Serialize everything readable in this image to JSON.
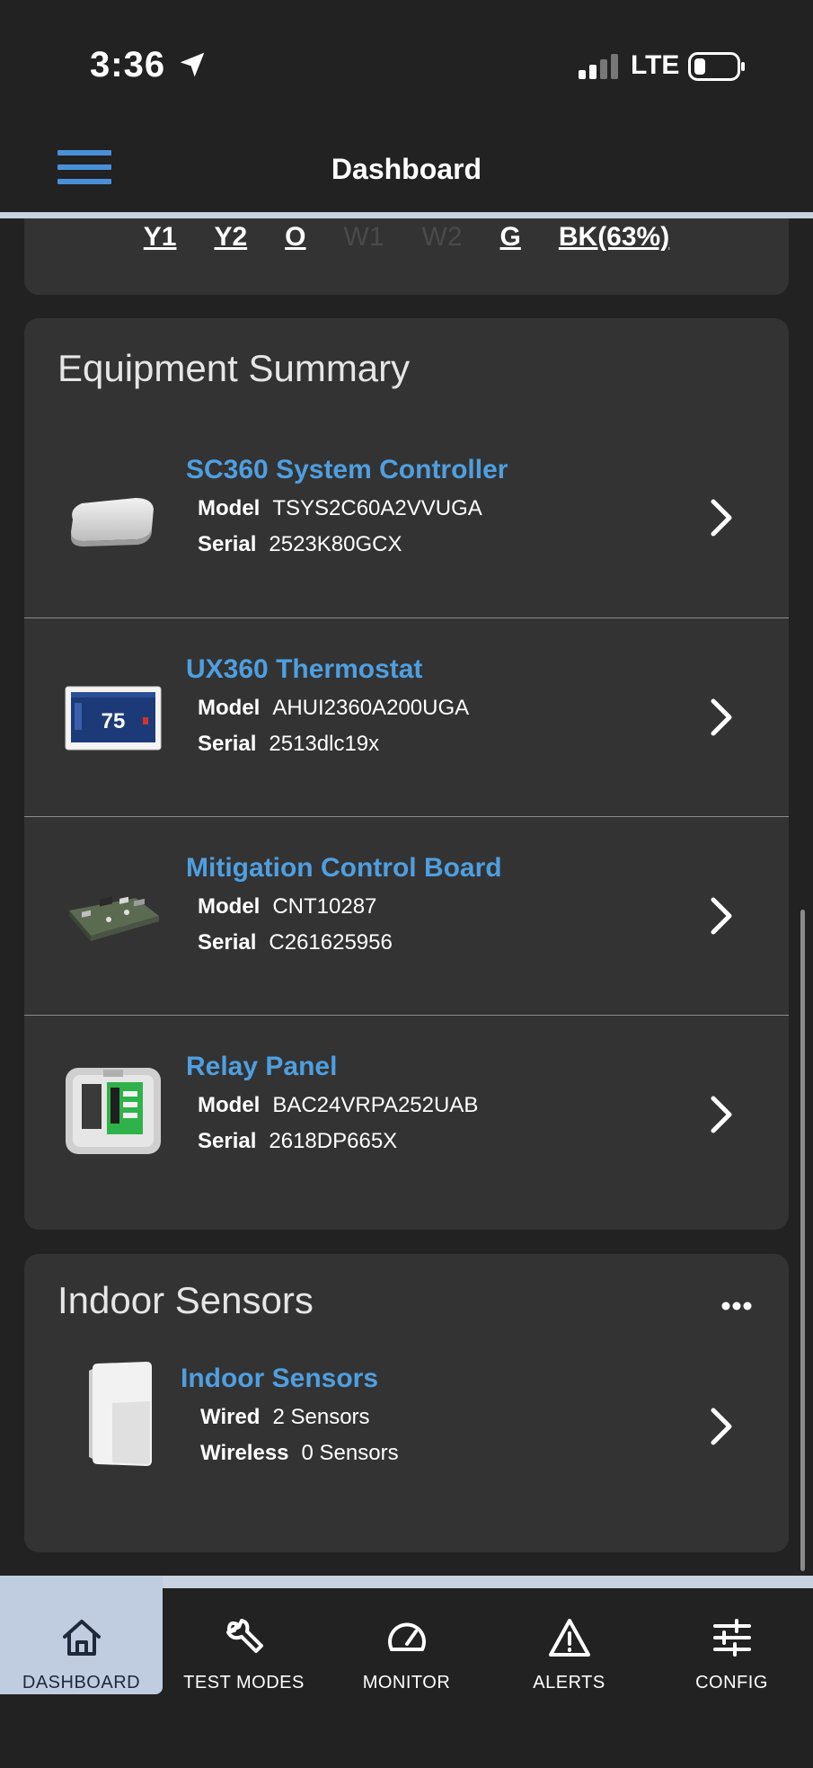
{
  "status_bar": {
    "time": "3:36",
    "network": "LTE"
  },
  "header": {
    "title": "Dashboard"
  },
  "stages": [
    {
      "label": "Y1",
      "active": true
    },
    {
      "label": "Y2",
      "active": true
    },
    {
      "label": "O",
      "active": true
    },
    {
      "label": "W1",
      "active": false
    },
    {
      "label": "W2",
      "active": false
    },
    {
      "label": "G",
      "active": true
    },
    {
      "label": "BK(63%)",
      "active": true
    }
  ],
  "equipment": {
    "title": "Equipment Summary",
    "items": [
      {
        "name": "SC360 System Controller",
        "model_label": "Model",
        "model": "TSYS2C60A2VVUGA",
        "serial_label": "Serial",
        "serial": "2523K80GCX",
        "icon": "controller-icon"
      },
      {
        "name": "UX360 Thermostat",
        "model_label": "Model",
        "model": "AHUI2360A200UGA",
        "serial_label": "Serial",
        "serial": "2513dlc19x",
        "icon": "thermostat-icon",
        "screen_temp": "75"
      },
      {
        "name": "Mitigation Control Board",
        "model_label": "Model",
        "model": "CNT10287",
        "serial_label": "Serial",
        "serial": "C261625956",
        "icon": "circuit-board-icon"
      },
      {
        "name": "Relay Panel",
        "model_label": "Model",
        "model": "BAC24VRPA252UAB",
        "serial_label": "Serial",
        "serial": "2618DP665X",
        "icon": "relay-panel-icon"
      }
    ]
  },
  "sensors": {
    "title": "Indoor Sensors",
    "item": {
      "name": "Indoor Sensors",
      "wired_label": "Wired",
      "wired": "2 Sensors",
      "wireless_label": "Wireless",
      "wireless": "0 Sensors"
    }
  },
  "tabs": [
    {
      "label": "DASHBOARD",
      "icon": "home-icon",
      "active": true
    },
    {
      "label": "TEST MODES",
      "icon": "wrench-icon",
      "active": false
    },
    {
      "label": "MONITOR",
      "icon": "gauge-icon",
      "active": false
    },
    {
      "label": "ALERTS",
      "icon": "warning-icon",
      "active": false
    },
    {
      "label": "CONFIG",
      "icon": "sliders-icon",
      "active": false
    }
  ],
  "colors": {
    "accent": "#4f9fe0",
    "background": "#222222",
    "card": "#333333",
    "active_tab": "#c0cde0"
  }
}
